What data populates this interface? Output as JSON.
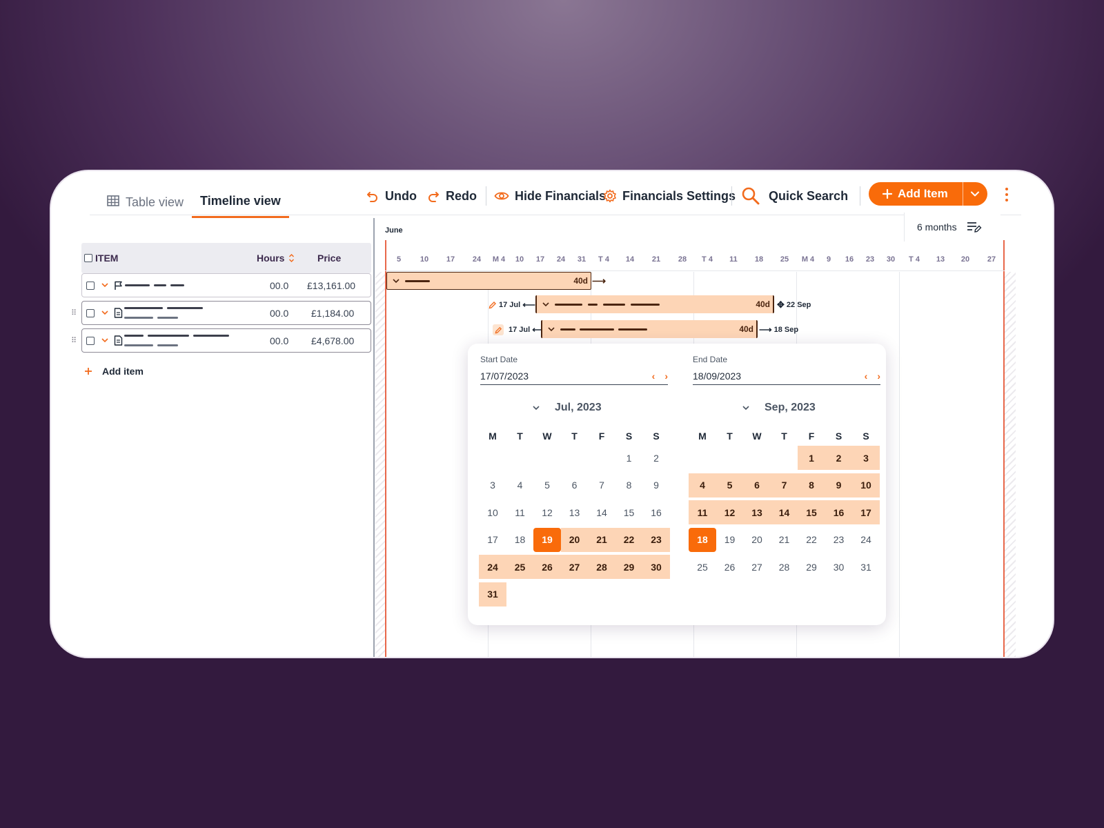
{
  "tabs": [
    {
      "label": "Table view",
      "icon": "table-icon",
      "active": false
    },
    {
      "label": "Timeline view",
      "active": true
    }
  ],
  "toolbar": {
    "undo": "Undo",
    "redo": "Redo",
    "hide_financials": "Hide Financials",
    "financials_settings": "Financials Settings",
    "quick_search": "Quick Search",
    "add_item": "Add Item"
  },
  "colors": {
    "accent": "#f96b0a",
    "range": "#fdd5b6",
    "today_line": "#e8674a"
  },
  "table": {
    "headers": {
      "item": "ITEM",
      "hours": "Hours",
      "price": "Price"
    },
    "rows": [
      {
        "hours": "00.0",
        "price": "£13,161.00",
        "icon": "flag-icon"
      },
      {
        "hours": "00.0",
        "price": "£1,184.00",
        "icon": "document-icon"
      },
      {
        "hours": "00.0",
        "price": "£4,678.00",
        "icon": "document-icon"
      }
    ],
    "add_item": "Add item"
  },
  "timeline": {
    "month_label": "June",
    "zoom": "6 months",
    "ticks": [
      "5",
      "10",
      "17",
      "24",
      "M 4",
      "10",
      "17",
      "24",
      "31",
      "T 4",
      "14",
      "21",
      "28",
      "T 4",
      "11",
      "18",
      "25",
      "M 4",
      "9",
      "16",
      "23",
      "30",
      "T 4",
      "13",
      "20",
      "27"
    ],
    "bars": [
      {
        "duration": "40d"
      },
      {
        "duration": "40d",
        "start": "17 Jul",
        "end": "22 Sep"
      },
      {
        "duration": "40d",
        "start": "17 Jul",
        "end": "18 Sep"
      }
    ]
  },
  "datepicker": {
    "start_label": "Start Date",
    "start_value": "17/07/2023",
    "end_label": "End Date",
    "end_value": "18/09/2023",
    "left_month": "Jul, 2023",
    "right_month": "Sep, 2023",
    "weekdays": [
      "M",
      "T",
      "W",
      "T",
      "F",
      "S",
      "S"
    ]
  }
}
